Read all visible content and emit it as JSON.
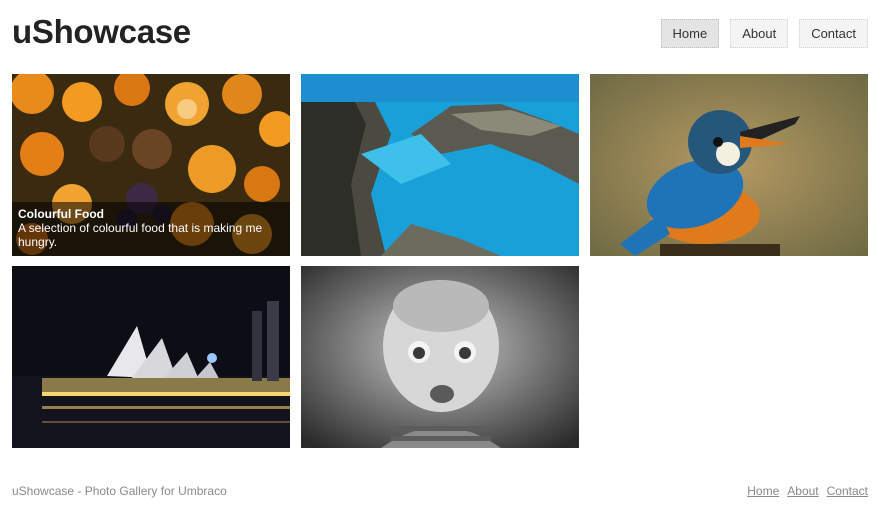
{
  "header": {
    "logo": "uShowcase"
  },
  "nav": {
    "items": [
      {
        "label": "Home",
        "active": true
      },
      {
        "label": "About",
        "active": false
      },
      {
        "label": "Contact",
        "active": false
      }
    ]
  },
  "gallery": {
    "tiles": [
      {
        "name": "colourful-food",
        "title": "Colourful Food",
        "description": "A selection of colourful food that is making me hungry."
      },
      {
        "name": "coastal-cliffs"
      },
      {
        "name": "kingfisher"
      },
      {
        "name": "sydney-opera-house"
      },
      {
        "name": "baby-portrait"
      }
    ]
  },
  "footer": {
    "text": "uShowcase - Photo Gallery for Umbraco",
    "links": [
      "Home",
      "About",
      "Contact"
    ]
  }
}
